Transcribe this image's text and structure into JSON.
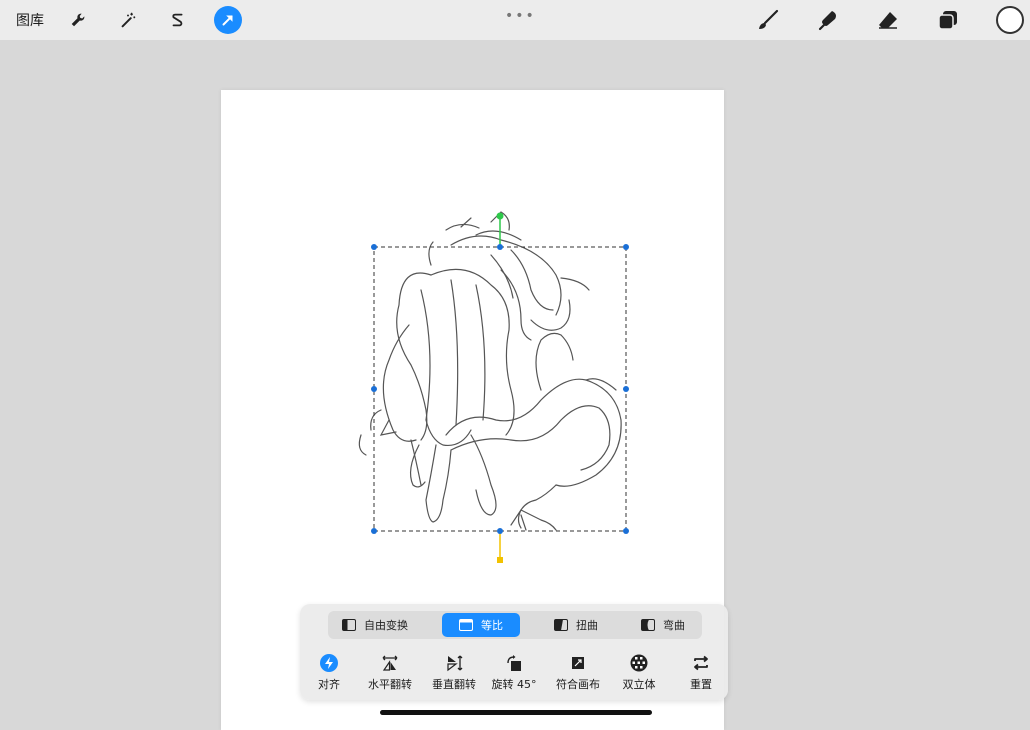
{
  "topbar": {
    "gallery_label": "图库",
    "left_tools": [
      "wrench-icon",
      "magic-wand-icon",
      "selection-s-icon",
      "transform-arrow-icon"
    ],
    "active_tool": "transform-arrow-icon",
    "more": "•••",
    "right_tools": [
      "brush-icon",
      "smudge-icon",
      "eraser-icon",
      "layers-icon"
    ],
    "current_color": "#ffffff"
  },
  "transform": {
    "modes": [
      {
        "label": "自由变换",
        "icon": "freeform-icon"
      },
      {
        "label": "等比",
        "icon": "uniform-icon"
      },
      {
        "label": "扭曲",
        "icon": "distort-icon"
      },
      {
        "label": "弯曲",
        "icon": "warp-icon"
      }
    ],
    "active_mode": "等比",
    "actions": [
      {
        "label": "对齐",
        "icon": "snap-icon"
      },
      {
        "label": "水平翻转",
        "icon": "flip-horizontal-icon"
      },
      {
        "label": "垂直翻转",
        "icon": "flip-vertical-icon"
      },
      {
        "label": "旋转 45°",
        "icon": "rotate-45-icon"
      },
      {
        "label": "符合画布",
        "icon": "fit-canvas-icon"
      },
      {
        "label": "双立体",
        "icon": "bicubic-icon"
      },
      {
        "label": "重置",
        "icon": "reset-icon"
      }
    ]
  },
  "colors": {
    "accent": "#1a8cff",
    "handle": "#1a6fd6",
    "rotate_handle": "#2ec94a",
    "pivot_handle": "#f2c200"
  }
}
